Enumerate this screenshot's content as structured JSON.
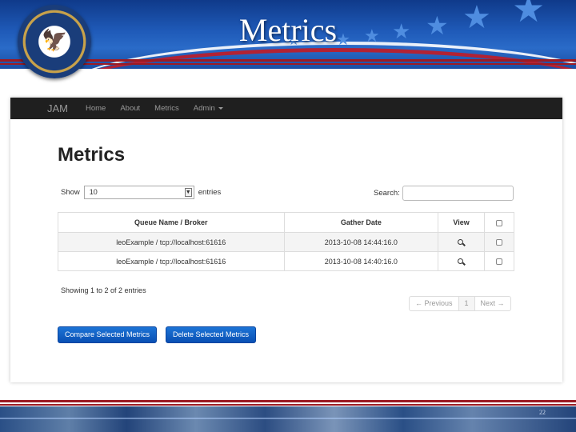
{
  "slide": {
    "title": "Metrics",
    "slide_number": "22"
  },
  "navbar": {
    "brand": "JAM",
    "links": [
      "Home",
      "About",
      "Metrics"
    ],
    "admin_label": "Admin"
  },
  "page": {
    "title": "Metrics"
  },
  "length_control": {
    "show_label": "Show",
    "selected": "10",
    "entries_label": "entries"
  },
  "search": {
    "label": "Search:",
    "value": ""
  },
  "table": {
    "columns": [
      "Queue Name / Broker",
      "Gather Date",
      "View"
    ],
    "rows": [
      {
        "queue": "leoExample / tcp://localhost:61616",
        "date": "2013-10-08 14:44:16.0"
      },
      {
        "queue": "leoExample / tcp://localhost:61616",
        "date": "2013-10-08 14:40:16.0"
      }
    ]
  },
  "info": "Showing 1 to 2 of 2 entries",
  "pagination": {
    "previous": "← Previous",
    "current": "1",
    "next": "Next →"
  },
  "actions": {
    "compare": "Compare Selected Metrics",
    "delete": "Delete Selected Metrics"
  },
  "colors": {
    "navbar_bg": "#1f1f1f",
    "primary_button": "#0a5ccc",
    "banner_blue": "#1f5ab8",
    "accent_red": "#9b1b24"
  }
}
